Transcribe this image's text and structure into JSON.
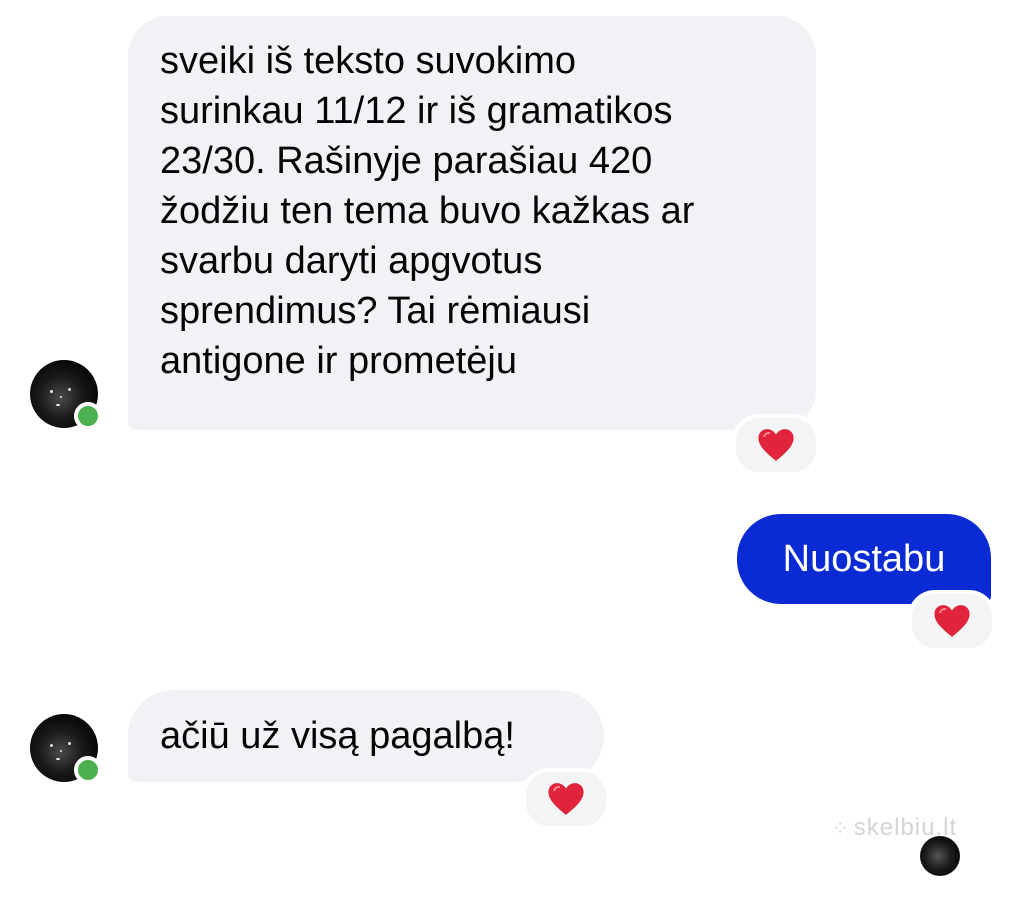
{
  "messages": [
    {
      "direction": "incoming",
      "text": "sveiki iš teksto suvokimo\nsurinkau 11/12 ir iš gramatikos\n23/30. Rašinyje parašiau 420\nžodžiu ten tema buvo kažkas ar\nsvarbu daryti apgvotus\nsprendimus? Tai rėmiausi\nantigone ir prometėju",
      "reaction": "heart"
    },
    {
      "direction": "outgoing",
      "text": "Nuostabu",
      "reaction": "heart"
    },
    {
      "direction": "incoming",
      "text": "ačiū už visą pagalbą!",
      "reaction": "heart"
    }
  ],
  "watermark": "skelbiu.lt",
  "colors": {
    "incoming_bubble": "#f0f2f5",
    "outgoing_bubble": "#0a2ad3",
    "heart": "#e0243c",
    "online": "#4caf50"
  }
}
